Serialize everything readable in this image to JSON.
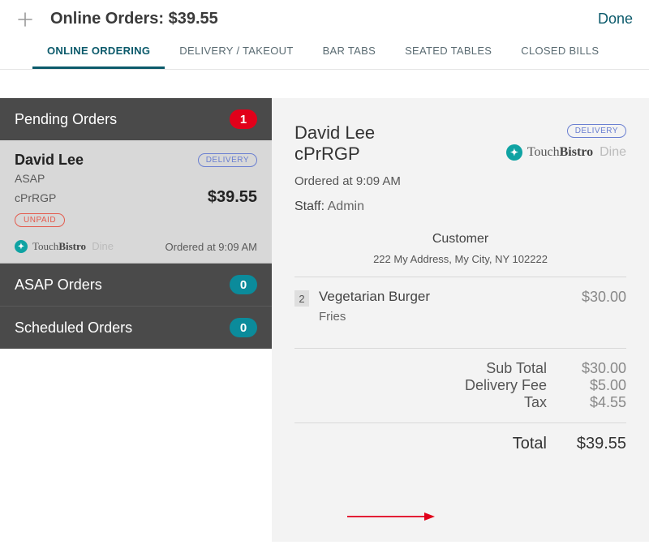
{
  "header": {
    "title": "Online Orders: $39.55",
    "done": "Done"
  },
  "tabs": {
    "online_ordering": "ONLINE ORDERING",
    "delivery_takeout": "DELIVERY / TAKEOUT",
    "bar_tabs": "BAR TABS",
    "seated_tables": "SEATED TABLES",
    "closed_bills": "CLOSED BILLS"
  },
  "sidebar": {
    "pending": {
      "label": "Pending Orders",
      "count": "1"
    },
    "asap": {
      "label": "ASAP Orders",
      "count": "0"
    },
    "scheduled": {
      "label": "Scheduled Orders",
      "count": "0"
    },
    "order": {
      "name": "David Lee",
      "type_pill": "DELIVERY",
      "timing": "ASAP",
      "code": "cPrRGP",
      "amount": "$39.55",
      "unpaid": "UNPAID",
      "ordered_at": "Ordered at 9:09 AM",
      "brand_touch": "Touch",
      "brand_bistro": "Bistro",
      "brand_suffix": "Dine"
    }
  },
  "detail": {
    "name": "David Lee",
    "code": "cPrRGP",
    "type_pill": "DELIVERY",
    "brand_touch": "Touch",
    "brand_bistro": "Bistro",
    "brand_suffix": "Dine",
    "ordered_at": "Ordered at 9:09 AM",
    "staff_label": "Staff:",
    "staff_value": "Admin",
    "customer_label": "Customer",
    "customer_address": "222 My Address, My City, NY 102222",
    "item": {
      "qty": "2",
      "name": "Vegetarian Burger",
      "price": "$30.00",
      "modifier": "Fries"
    },
    "totals": {
      "subtotal_label": "Sub Total",
      "subtotal_value": "$30.00",
      "delivery_label": "Delivery Fee",
      "delivery_value": "$5.00",
      "tax_label": "Tax",
      "tax_value": "$4.55",
      "total_label": "Total",
      "total_value": "$39.55"
    }
  }
}
